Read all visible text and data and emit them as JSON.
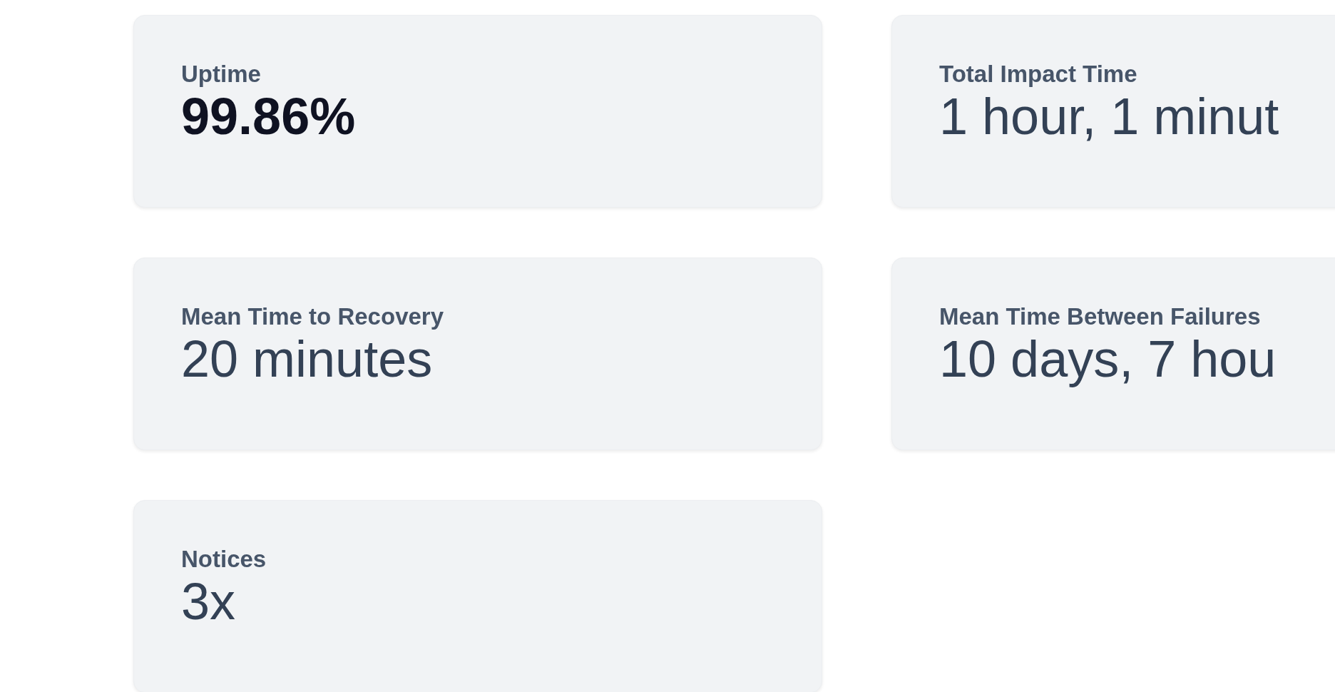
{
  "stats": [
    {
      "label": "Uptime",
      "value": "99.86%",
      "kind": "highlight"
    },
    {
      "label": "Total Impact Time",
      "value": "1 hour, 1 minut",
      "kind": "plain"
    },
    {
      "label": "Mean Time to Recovery",
      "value": "20 minutes",
      "kind": "plain"
    },
    {
      "label": "Mean Time Between Failures",
      "value": "10 days, 7 hou",
      "kind": "plain"
    },
    {
      "label": "Notices",
      "value": "3x",
      "kind": "plain"
    }
  ]
}
